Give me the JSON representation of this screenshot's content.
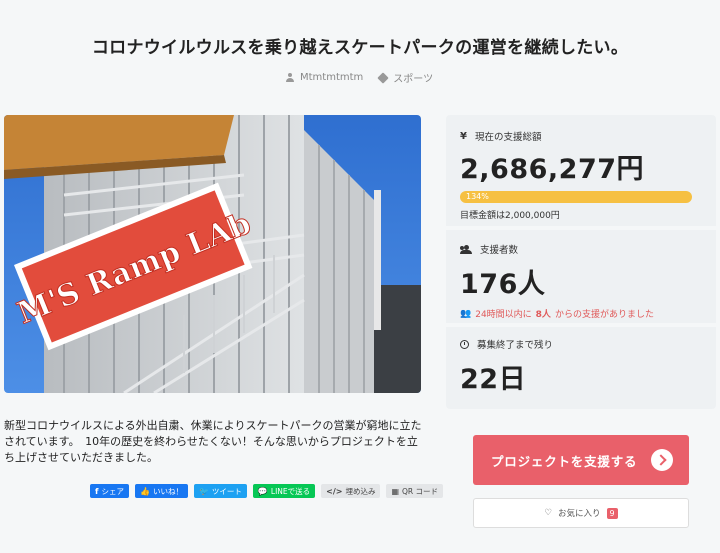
{
  "page": {
    "title": "コロナウイルウルスを乗り越えスケートパークの運営を継続したい。",
    "author": "Mtmtmtmtm",
    "category": "スポーツ"
  },
  "hero": {
    "sign_text": "M'S Ramp LAb"
  },
  "description": "新型コロナウイルスによる外出自粛、休業によりスケートパークの営業が窮地に立たされています。　10年の歴史を終わらせたくない！そんな思いからプロジェクトを立ち上げさせていただきました。",
  "share": {
    "facebook": "シェア",
    "like": "いいね！",
    "tweet": "ツイート",
    "line": "LINEで送る",
    "embed": "埋め込み",
    "qr": "QR コード"
  },
  "stats": {
    "funding_label": "現在の支援総額",
    "funding_amount": "2,686,277円",
    "progress_text": "134%",
    "progress_percent": 134,
    "goal_text": "目標金額は2,000,000円",
    "supporters_label": "支援者数",
    "supporters_count": "176人",
    "recent_prefix": "24時間以内に",
    "recent_count": "8人",
    "recent_suffix": "からの支援がありました",
    "remaining_label": "募集終了まで残り",
    "remaining_days": "22日"
  },
  "actions": {
    "support_label": "プロジェクトを支援する",
    "favorite_label": "お気に入り",
    "favorite_count": "9"
  },
  "colors": {
    "accent": "#e9606a",
    "progress": "#f6c042"
  }
}
